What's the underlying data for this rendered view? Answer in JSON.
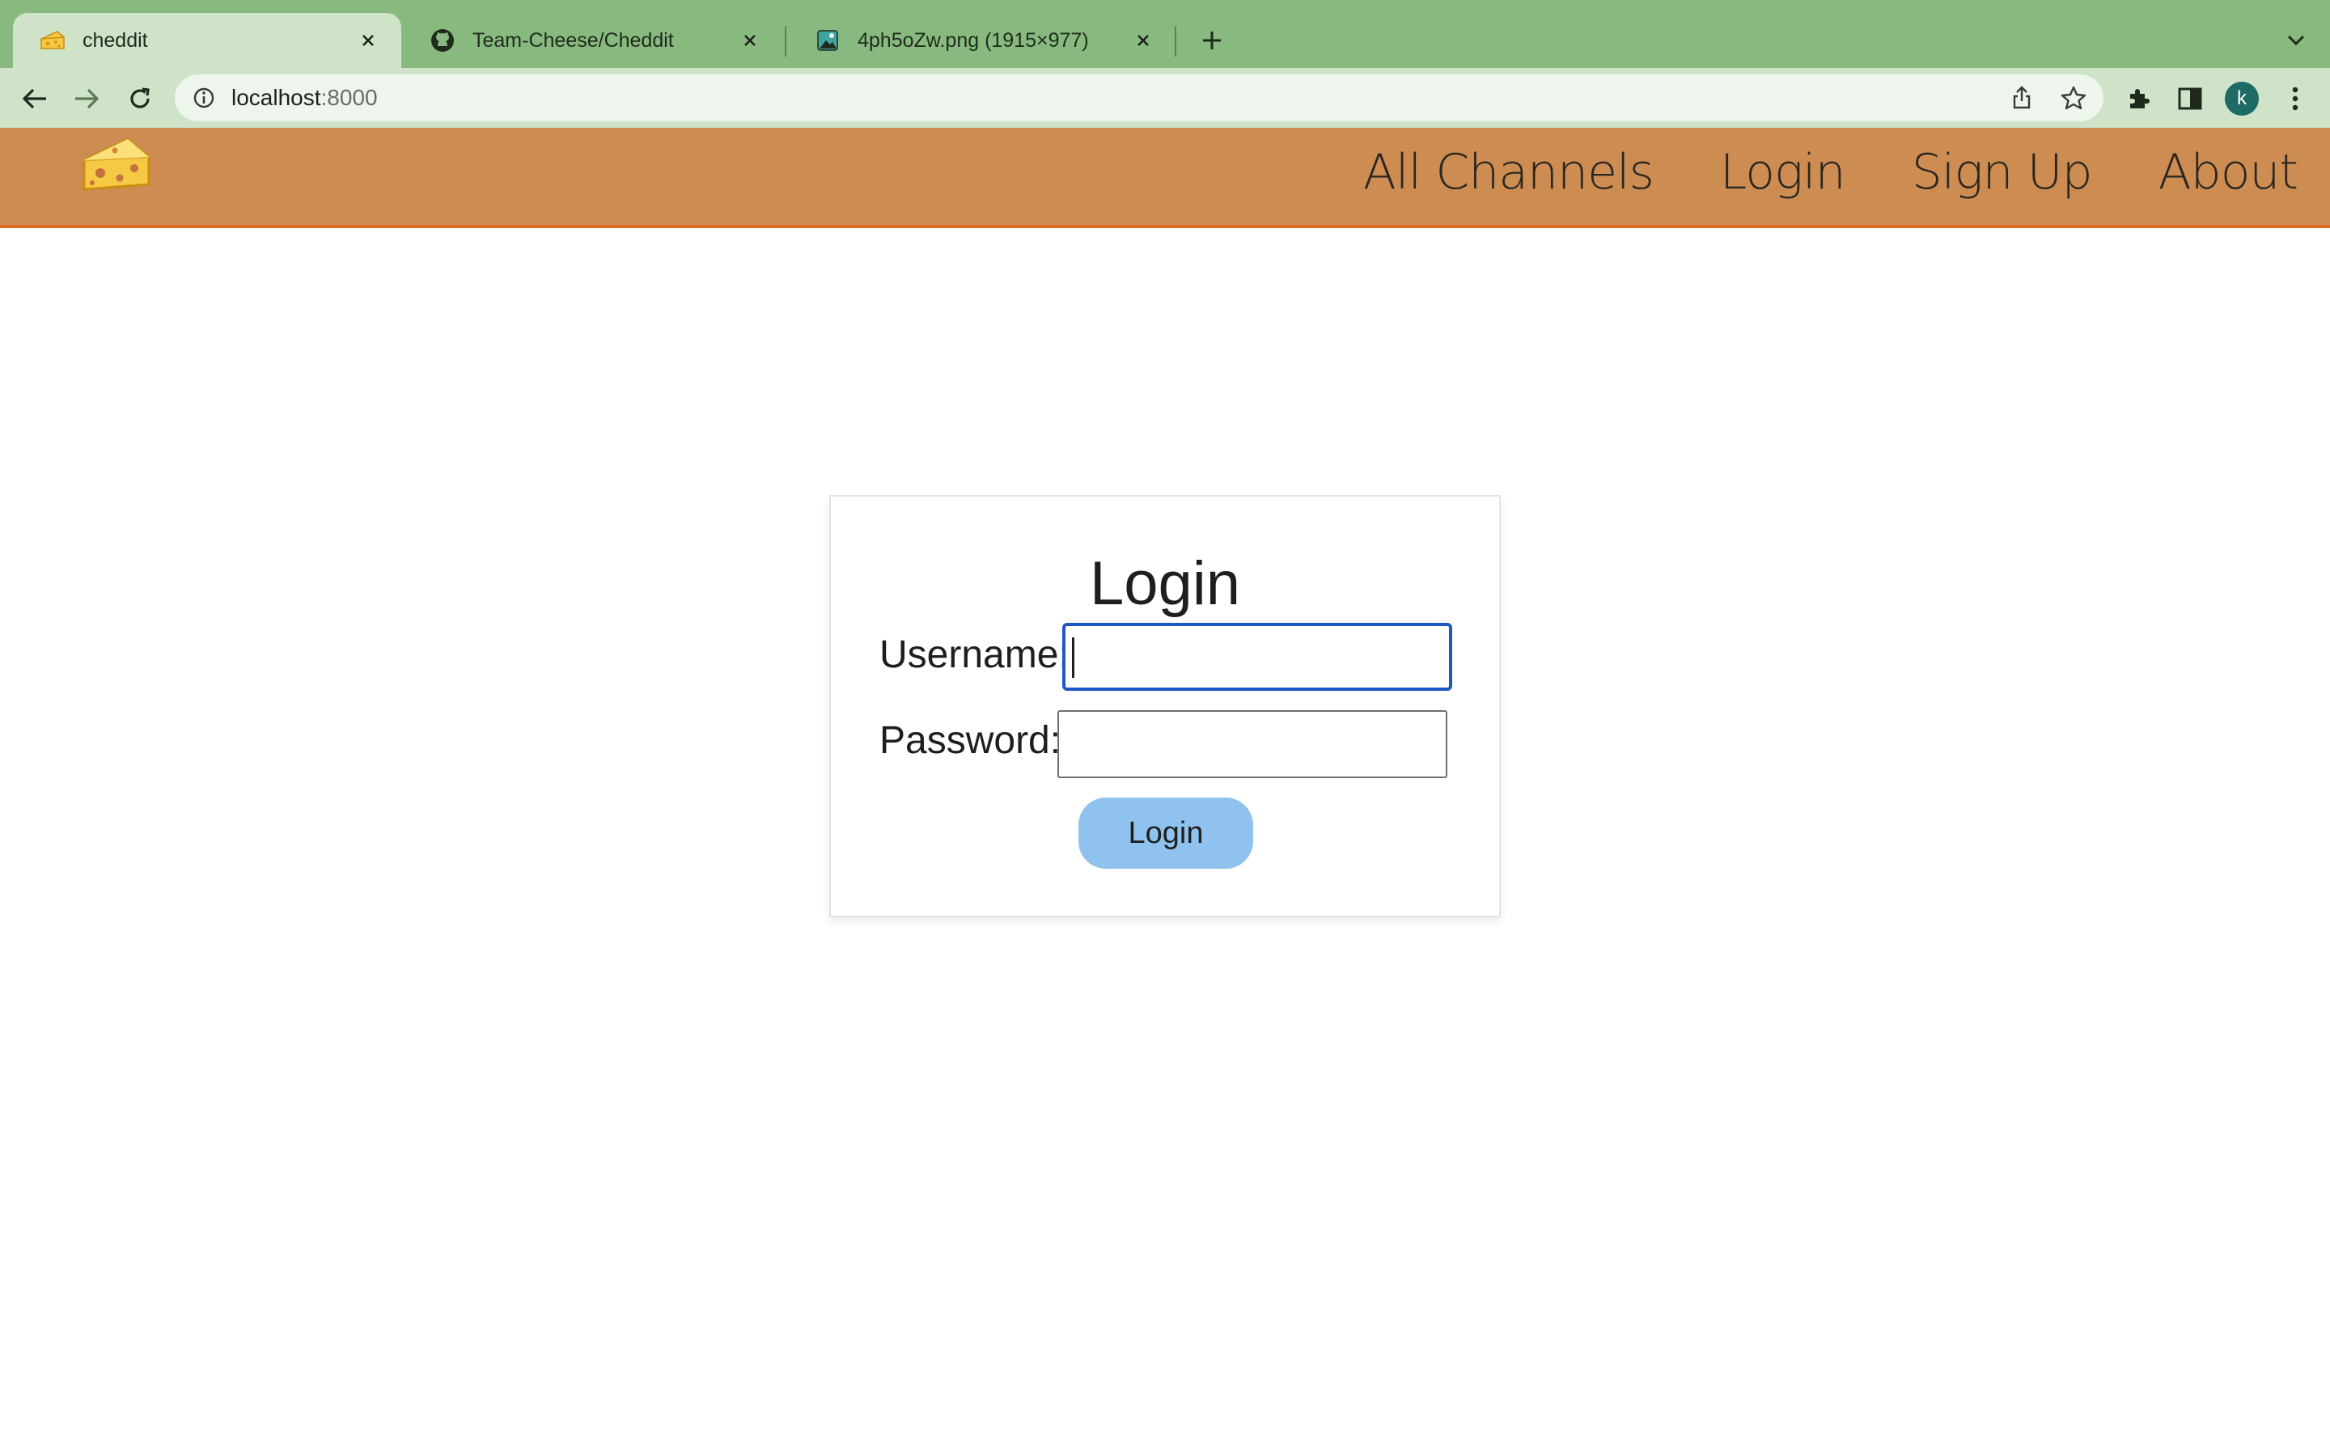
{
  "browser": {
    "tabs": [
      {
        "title": "cheddit",
        "active": true
      },
      {
        "title": "Team-Cheese/Cheddit",
        "active": false
      },
      {
        "title": "4ph5oZw.png (1915×977)",
        "active": false
      }
    ],
    "url_host": "localhost",
    "url_port": ":8000",
    "profile_initial": "k"
  },
  "colors": {
    "tabstrip": "#88b97f",
    "toolbar": "#cfe3c8",
    "header": "#cd8d52",
    "header_border": "#e46a2a",
    "button": "#8fc2ee",
    "focus_ring": "#1f57c4"
  },
  "site": {
    "logo_icon": "cheese-icon",
    "nav": [
      "All Channels",
      "Login",
      "Sign Up",
      "About"
    ]
  },
  "login_form": {
    "title": "Login",
    "username_label": "Username:",
    "username_value": "",
    "password_label": "Password:",
    "password_value": "",
    "submit_label": "Login"
  }
}
